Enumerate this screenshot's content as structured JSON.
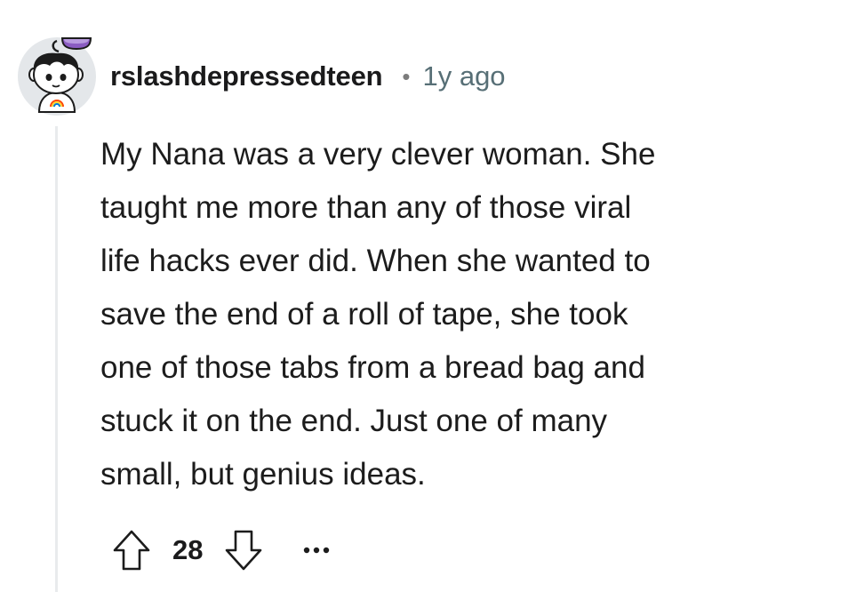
{
  "comment": {
    "author": "rslashdepressedteen",
    "separator": "•",
    "timestamp": "1y ago",
    "body_lines": [
      "My Nana was a very clever woman. She",
      "taught me more than any of those viral",
      "life hacks ever did. When she wanted to",
      "save the end of a roll of tape, she took",
      "one of those tabs from a bread bag and",
      "stuck it on the end. Just one of many",
      "small, but genius ideas."
    ],
    "score": "28",
    "avatar_icon": "snoo-avatar-icon"
  },
  "icons": {
    "upvote": "arrow-up-icon",
    "downvote": "arrow-down-icon",
    "more": "ellipsis-icon"
  },
  "colors": {
    "text": "#1c1c1c",
    "meta": "#576f76",
    "thread_line": "#e9ebed",
    "icon_stroke": "#1c1c1c"
  }
}
